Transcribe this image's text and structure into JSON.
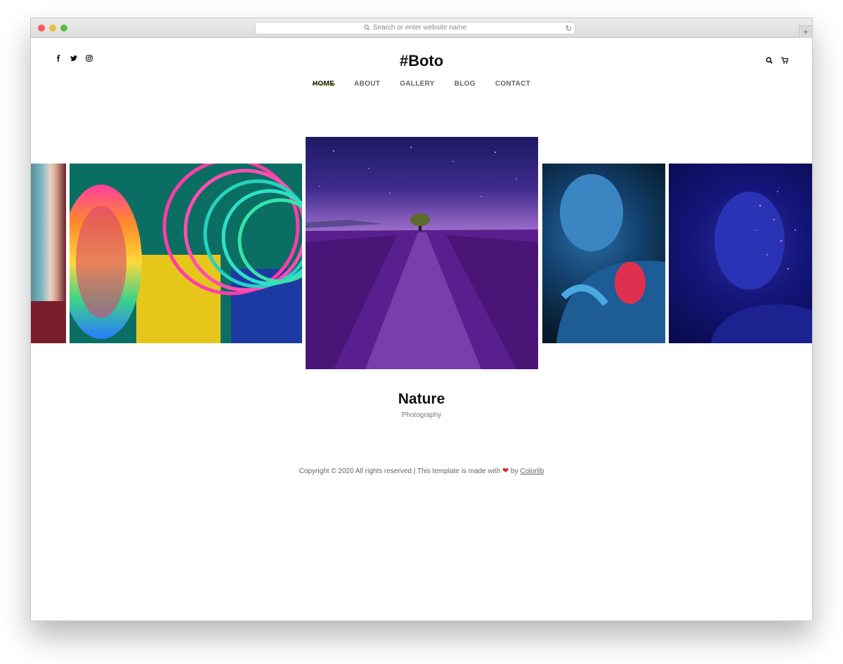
{
  "browser": {
    "url_placeholder": "Search or enter website name",
    "new_tab_label": "+"
  },
  "header": {
    "brand": "#Boto",
    "social_icons": [
      "facebook-icon",
      "twitter-icon",
      "instagram-icon"
    ],
    "tool_icons": [
      "search-icon",
      "cart-icon"
    ]
  },
  "nav": {
    "items": [
      {
        "label": "HOME",
        "active": true
      },
      {
        "label": "ABOUT",
        "active": false
      },
      {
        "label": "GALLERY",
        "active": false
      },
      {
        "label": "BLOG",
        "active": false
      },
      {
        "label": "CONTACT",
        "active": false
      }
    ]
  },
  "slider": {
    "current_title": "Nature",
    "current_subtitle": "Photography"
  },
  "footer": {
    "text_before": "Copyright © 2020 All rights reserved | This template is made with ",
    "heart": "❤",
    "text_by": " by ",
    "link": "Colorlib"
  },
  "colors": {
    "accent_underline": "#6a8a1e",
    "heart": "#d9252a"
  }
}
